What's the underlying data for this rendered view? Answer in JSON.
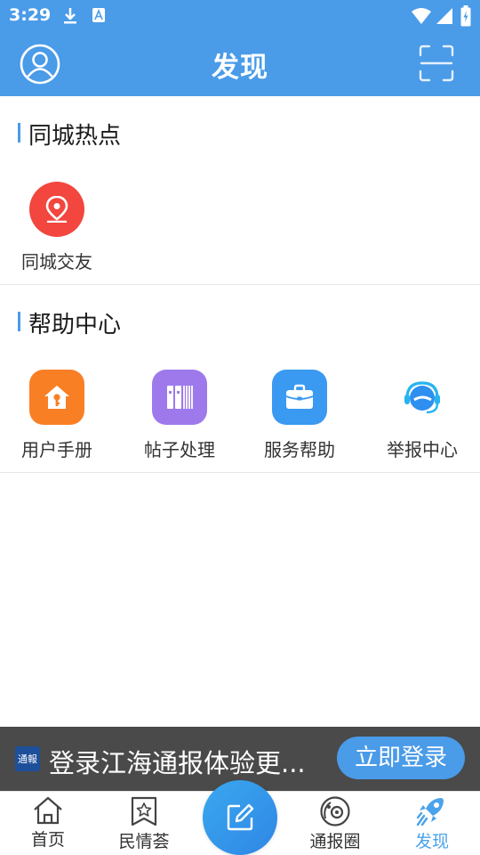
{
  "status_bar": {
    "time": "3:29"
  },
  "header": {
    "title": "发现"
  },
  "section_city": {
    "title": "同城热点",
    "items": [
      {
        "label": "同城交友",
        "icon": "location-pin-icon",
        "color": "#f2463f"
      }
    ]
  },
  "section_help": {
    "title": "帮助中心",
    "items": [
      {
        "label": "用户手册",
        "icon": "house-key-icon",
        "color": "#f97f25"
      },
      {
        "label": "帖子处理",
        "icon": "books-icon",
        "color": "#9d79ec"
      },
      {
        "label": "服务帮助",
        "icon": "briefcase-icon",
        "color": "#3a99f1"
      },
      {
        "label": "举报中心",
        "icon": "headset-icon",
        "color": "#2d8ff0"
      }
    ]
  },
  "login_banner": {
    "logo_text": "通報",
    "text": "登录江海通报体验更...",
    "button": "立即登录"
  },
  "tab_bar": {
    "tabs": [
      {
        "label": "首页",
        "icon": "home-icon"
      },
      {
        "label": "民情荟",
        "icon": "star-bookmark-icon"
      },
      {
        "label": "通报圈",
        "icon": "orbit-icon"
      },
      {
        "label": "发现",
        "icon": "rocket-icon",
        "active": true
      }
    ],
    "compose": {
      "icon": "edit-icon"
    }
  },
  "colors": {
    "primary": "#4a9be8",
    "active_tab": "#4aa3ea"
  }
}
